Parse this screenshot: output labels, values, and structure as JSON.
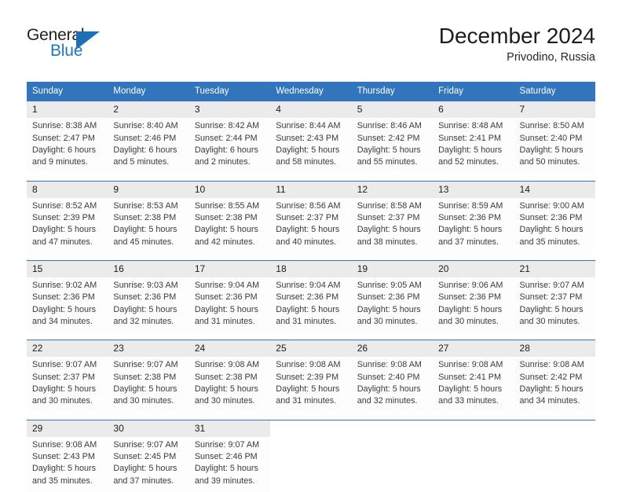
{
  "brand": {
    "name_top": "General",
    "name_bottom": "Blue",
    "triangle_icon": "blue-triangle-icon",
    "color_dark": "#231f20",
    "color_blue": "#2077c0"
  },
  "header": {
    "title": "December 2024",
    "subtitle": "Privodino, Russia"
  },
  "theme": {
    "header_bg": "#3275bc",
    "daynum_bg": "#ebebeb",
    "cell_bg": "#fdfdfd",
    "text": "#3a3a3a"
  },
  "calendar": {
    "weekday_headers": [
      "Sunday",
      "Monday",
      "Tuesday",
      "Wednesday",
      "Thursday",
      "Friday",
      "Saturday"
    ],
    "weeks": [
      {
        "days": [
          {
            "num": "1",
            "sunrise": "Sunrise: 8:38 AM",
            "sunset": "Sunset: 2:47 PM",
            "daylight1": "Daylight: 6 hours",
            "daylight2": "and 9 minutes."
          },
          {
            "num": "2",
            "sunrise": "Sunrise: 8:40 AM",
            "sunset": "Sunset: 2:46 PM",
            "daylight1": "Daylight: 6 hours",
            "daylight2": "and 5 minutes."
          },
          {
            "num": "3",
            "sunrise": "Sunrise: 8:42 AM",
            "sunset": "Sunset: 2:44 PM",
            "daylight1": "Daylight: 6 hours",
            "daylight2": "and 2 minutes."
          },
          {
            "num": "4",
            "sunrise": "Sunrise: 8:44 AM",
            "sunset": "Sunset: 2:43 PM",
            "daylight1": "Daylight: 5 hours",
            "daylight2": "and 58 minutes."
          },
          {
            "num": "5",
            "sunrise": "Sunrise: 8:46 AM",
            "sunset": "Sunset: 2:42 PM",
            "daylight1": "Daylight: 5 hours",
            "daylight2": "and 55 minutes."
          },
          {
            "num": "6",
            "sunrise": "Sunrise: 8:48 AM",
            "sunset": "Sunset: 2:41 PM",
            "daylight1": "Daylight: 5 hours",
            "daylight2": "and 52 minutes."
          },
          {
            "num": "7",
            "sunrise": "Sunrise: 8:50 AM",
            "sunset": "Sunset: 2:40 PM",
            "daylight1": "Daylight: 5 hours",
            "daylight2": "and 50 minutes."
          }
        ]
      },
      {
        "days": [
          {
            "num": "8",
            "sunrise": "Sunrise: 8:52 AM",
            "sunset": "Sunset: 2:39 PM",
            "daylight1": "Daylight: 5 hours",
            "daylight2": "and 47 minutes."
          },
          {
            "num": "9",
            "sunrise": "Sunrise: 8:53 AM",
            "sunset": "Sunset: 2:38 PM",
            "daylight1": "Daylight: 5 hours",
            "daylight2": "and 45 minutes."
          },
          {
            "num": "10",
            "sunrise": "Sunrise: 8:55 AM",
            "sunset": "Sunset: 2:38 PM",
            "daylight1": "Daylight: 5 hours",
            "daylight2": "and 42 minutes."
          },
          {
            "num": "11",
            "sunrise": "Sunrise: 8:56 AM",
            "sunset": "Sunset: 2:37 PM",
            "daylight1": "Daylight: 5 hours",
            "daylight2": "and 40 minutes."
          },
          {
            "num": "12",
            "sunrise": "Sunrise: 8:58 AM",
            "sunset": "Sunset: 2:37 PM",
            "daylight1": "Daylight: 5 hours",
            "daylight2": "and 38 minutes."
          },
          {
            "num": "13",
            "sunrise": "Sunrise: 8:59 AM",
            "sunset": "Sunset: 2:36 PM",
            "daylight1": "Daylight: 5 hours",
            "daylight2": "and 37 minutes."
          },
          {
            "num": "14",
            "sunrise": "Sunrise: 9:00 AM",
            "sunset": "Sunset: 2:36 PM",
            "daylight1": "Daylight: 5 hours",
            "daylight2": "and 35 minutes."
          }
        ]
      },
      {
        "days": [
          {
            "num": "15",
            "sunrise": "Sunrise: 9:02 AM",
            "sunset": "Sunset: 2:36 PM",
            "daylight1": "Daylight: 5 hours",
            "daylight2": "and 34 minutes."
          },
          {
            "num": "16",
            "sunrise": "Sunrise: 9:03 AM",
            "sunset": "Sunset: 2:36 PM",
            "daylight1": "Daylight: 5 hours",
            "daylight2": "and 32 minutes."
          },
          {
            "num": "17",
            "sunrise": "Sunrise: 9:04 AM",
            "sunset": "Sunset: 2:36 PM",
            "daylight1": "Daylight: 5 hours",
            "daylight2": "and 31 minutes."
          },
          {
            "num": "18",
            "sunrise": "Sunrise: 9:04 AM",
            "sunset": "Sunset: 2:36 PM",
            "daylight1": "Daylight: 5 hours",
            "daylight2": "and 31 minutes."
          },
          {
            "num": "19",
            "sunrise": "Sunrise: 9:05 AM",
            "sunset": "Sunset: 2:36 PM",
            "daylight1": "Daylight: 5 hours",
            "daylight2": "and 30 minutes."
          },
          {
            "num": "20",
            "sunrise": "Sunrise: 9:06 AM",
            "sunset": "Sunset: 2:36 PM",
            "daylight1": "Daylight: 5 hours",
            "daylight2": "and 30 minutes."
          },
          {
            "num": "21",
            "sunrise": "Sunrise: 9:07 AM",
            "sunset": "Sunset: 2:37 PM",
            "daylight1": "Daylight: 5 hours",
            "daylight2": "and 30 minutes."
          }
        ]
      },
      {
        "days": [
          {
            "num": "22",
            "sunrise": "Sunrise: 9:07 AM",
            "sunset": "Sunset: 2:37 PM",
            "daylight1": "Daylight: 5 hours",
            "daylight2": "and 30 minutes."
          },
          {
            "num": "23",
            "sunrise": "Sunrise: 9:07 AM",
            "sunset": "Sunset: 2:38 PM",
            "daylight1": "Daylight: 5 hours",
            "daylight2": "and 30 minutes."
          },
          {
            "num": "24",
            "sunrise": "Sunrise: 9:08 AM",
            "sunset": "Sunset: 2:38 PM",
            "daylight1": "Daylight: 5 hours",
            "daylight2": "and 30 minutes."
          },
          {
            "num": "25",
            "sunrise": "Sunrise: 9:08 AM",
            "sunset": "Sunset: 2:39 PM",
            "daylight1": "Daylight: 5 hours",
            "daylight2": "and 31 minutes."
          },
          {
            "num": "26",
            "sunrise": "Sunrise: 9:08 AM",
            "sunset": "Sunset: 2:40 PM",
            "daylight1": "Daylight: 5 hours",
            "daylight2": "and 32 minutes."
          },
          {
            "num": "27",
            "sunrise": "Sunrise: 9:08 AM",
            "sunset": "Sunset: 2:41 PM",
            "daylight1": "Daylight: 5 hours",
            "daylight2": "and 33 minutes."
          },
          {
            "num": "28",
            "sunrise": "Sunrise: 9:08 AM",
            "sunset": "Sunset: 2:42 PM",
            "daylight1": "Daylight: 5 hours",
            "daylight2": "and 34 minutes."
          }
        ]
      },
      {
        "days": [
          {
            "num": "29",
            "sunrise": "Sunrise: 9:08 AM",
            "sunset": "Sunset: 2:43 PM",
            "daylight1": "Daylight: 5 hours",
            "daylight2": "and 35 minutes."
          },
          {
            "num": "30",
            "sunrise": "Sunrise: 9:07 AM",
            "sunset": "Sunset: 2:45 PM",
            "daylight1": "Daylight: 5 hours",
            "daylight2": "and 37 minutes."
          },
          {
            "num": "31",
            "sunrise": "Sunrise: 9:07 AM",
            "sunset": "Sunset: 2:46 PM",
            "daylight1": "Daylight: 5 hours",
            "daylight2": "and 39 minutes."
          },
          {
            "num": "",
            "sunrise": "",
            "sunset": "",
            "daylight1": "",
            "daylight2": ""
          },
          {
            "num": "",
            "sunrise": "",
            "sunset": "",
            "daylight1": "",
            "daylight2": ""
          },
          {
            "num": "",
            "sunrise": "",
            "sunset": "",
            "daylight1": "",
            "daylight2": ""
          },
          {
            "num": "",
            "sunrise": "",
            "sunset": "",
            "daylight1": "",
            "daylight2": ""
          }
        ]
      }
    ]
  }
}
